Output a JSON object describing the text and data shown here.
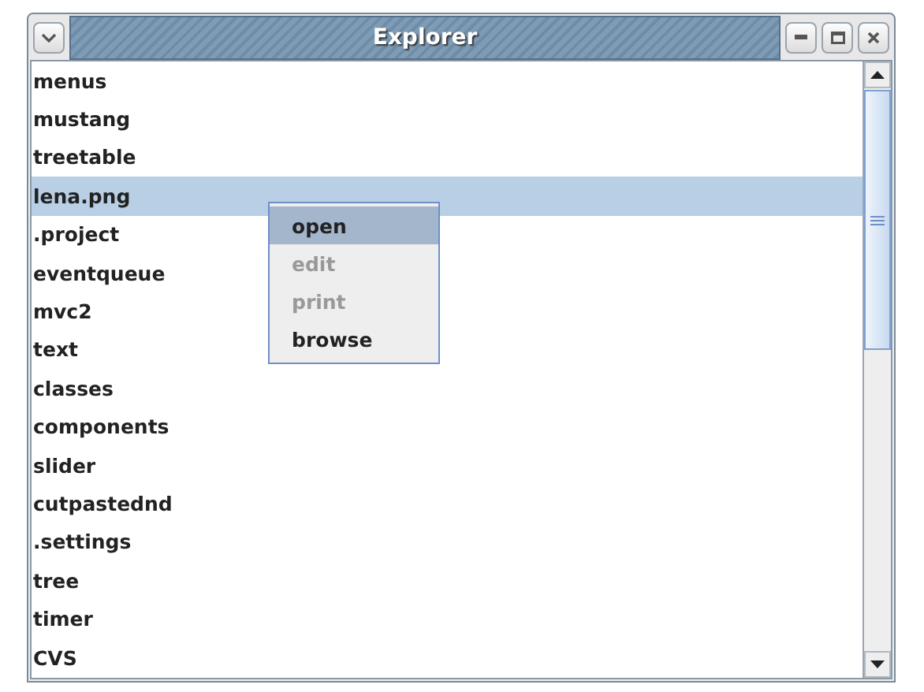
{
  "window": {
    "title": "Explorer"
  },
  "list": {
    "items": [
      {
        "label": "menus",
        "selected": false
      },
      {
        "label": "mustang",
        "selected": false
      },
      {
        "label": "treetable",
        "selected": false
      },
      {
        "label": "lena.png",
        "selected": true
      },
      {
        "label": ".project",
        "selected": false
      },
      {
        "label": "eventqueue",
        "selected": false
      },
      {
        "label": "mvc2",
        "selected": false
      },
      {
        "label": "text",
        "selected": false
      },
      {
        "label": "classes",
        "selected": false
      },
      {
        "label": "components",
        "selected": false
      },
      {
        "label": "slider",
        "selected": false
      },
      {
        "label": "cutpastednd",
        "selected": false
      },
      {
        "label": ".settings",
        "selected": false
      },
      {
        "label": "tree",
        "selected": false
      },
      {
        "label": "timer",
        "selected": false
      },
      {
        "label": "CVS",
        "selected": false
      }
    ]
  },
  "context_menu": {
    "items": [
      {
        "label": "open",
        "selected": true,
        "disabled": false
      },
      {
        "label": "edit",
        "selected": false,
        "disabled": true
      },
      {
        "label": "print",
        "selected": false,
        "disabled": true
      },
      {
        "label": "browse",
        "selected": false,
        "disabled": false
      }
    ]
  }
}
